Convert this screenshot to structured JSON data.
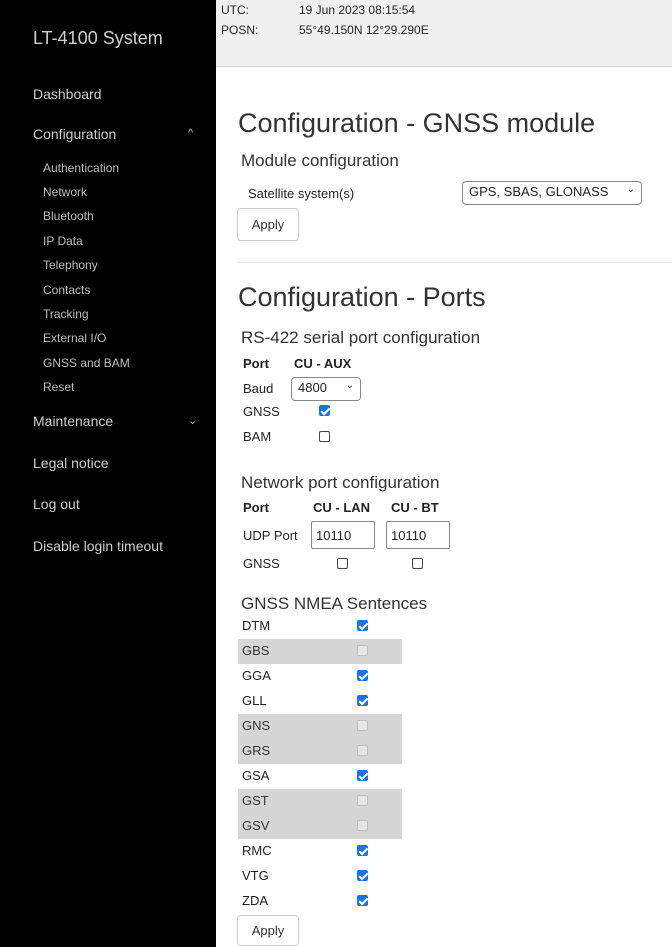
{
  "app_title": "LT-4100 System",
  "nav": {
    "dashboard": "Dashboard",
    "configuration": "Configuration",
    "config_items": [
      "Authentication",
      "Network",
      "Bluetooth",
      "IP Data",
      "Telephony",
      "Contacts",
      "Tracking",
      "External I/O",
      "GNSS and BAM",
      "Reset"
    ],
    "maintenance": "Maintenance",
    "legal": "Legal notice",
    "logout": "Log out",
    "disable_timeout": "Disable login timeout",
    "chevron_up": "^",
    "chevron_down": "⌄"
  },
  "status": {
    "utc_label": "UTC:",
    "utc_value": "19 Jun 2023 08:15:54",
    "posn_label": "POSN:",
    "posn_value": "55°49.150N 12°29.290E"
  },
  "gnss_module": {
    "title": "Configuration - GNSS module",
    "section": "Module configuration",
    "satellite_label": "Satellite system(s)",
    "satellite_value": "GPS, SBAS, GLONASS",
    "apply": "Apply"
  },
  "ports": {
    "title": "Configuration - Ports",
    "rs422": {
      "title": "RS-422 serial port configuration",
      "port_hdr": "Port",
      "cu_aux": "CU - AUX",
      "baud_label": "Baud",
      "baud_value": "4800",
      "gnss_label": "GNSS",
      "gnss_checked": true,
      "bam_label": "BAM",
      "bam_checked": false
    },
    "network": {
      "title": "Network port configuration",
      "port_hdr": "Port",
      "cu_lan": "CU - LAN",
      "cu_bt": "CU - BT",
      "udp_label": "UDP Port",
      "udp_lan": "10110",
      "udp_bt": "10110",
      "gnss_label": "GNSS",
      "gnss_lan": false,
      "gnss_bt": false
    }
  },
  "nmea": {
    "title": "GNSS NMEA Sentences",
    "sentences": [
      {
        "name": "DTM",
        "checked": true,
        "disabled": false
      },
      {
        "name": "GBS",
        "checked": false,
        "disabled": true
      },
      {
        "name": "GGA",
        "checked": true,
        "disabled": false
      },
      {
        "name": "GLL",
        "checked": true,
        "disabled": false
      },
      {
        "name": "GNS",
        "checked": false,
        "disabled": true
      },
      {
        "name": "GRS",
        "checked": false,
        "disabled": true
      },
      {
        "name": "GSA",
        "checked": true,
        "disabled": false
      },
      {
        "name": "GST",
        "checked": false,
        "disabled": true
      },
      {
        "name": "GSV",
        "checked": false,
        "disabled": true
      },
      {
        "name": "RMC",
        "checked": true,
        "disabled": false
      },
      {
        "name": "VTG",
        "checked": true,
        "disabled": false
      },
      {
        "name": "ZDA",
        "checked": true,
        "disabled": false
      }
    ],
    "apply": "Apply"
  }
}
